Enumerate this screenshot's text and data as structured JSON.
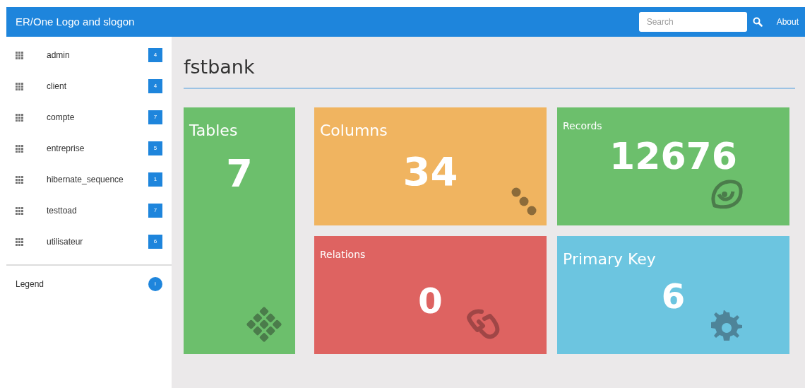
{
  "navbar": {
    "brand": "ER/One Logo and slogon",
    "search": {
      "placeholder": "Search"
    },
    "links": [
      "About"
    ]
  },
  "sidebar": {
    "items": [
      {
        "label": "admin",
        "count": "4"
      },
      {
        "label": "client",
        "count": "4"
      },
      {
        "label": "compte",
        "count": "7"
      },
      {
        "label": "entreprise",
        "count": "5"
      },
      {
        "label": "hibernate_sequence",
        "count": "1"
      },
      {
        "label": "testtoad",
        "count": "7"
      },
      {
        "label": "utilisateur",
        "count": "6"
      }
    ],
    "legend": {
      "label": "Legend",
      "badge": "i"
    }
  },
  "main": {
    "title": "fstbank",
    "tiles": [
      {
        "kind": "tables",
        "title": "Tables",
        "title_large": true,
        "value": "7",
        "color": "#6cbf6c"
      },
      {
        "kind": "columns",
        "title": "Columns",
        "title_large": true,
        "value": "34",
        "color": "#f0b460"
      },
      {
        "kind": "records",
        "title": "Records",
        "title_large": false,
        "value": "12676",
        "color": "#6cbf6c"
      },
      {
        "kind": "relations",
        "title": "Relations",
        "title_large": false,
        "value": "0",
        "color": "#de6361"
      },
      {
        "kind": "primary_key",
        "title": "Primary Key",
        "title_large": true,
        "value": "6",
        "color": "#6cc5e0"
      }
    ]
  }
}
